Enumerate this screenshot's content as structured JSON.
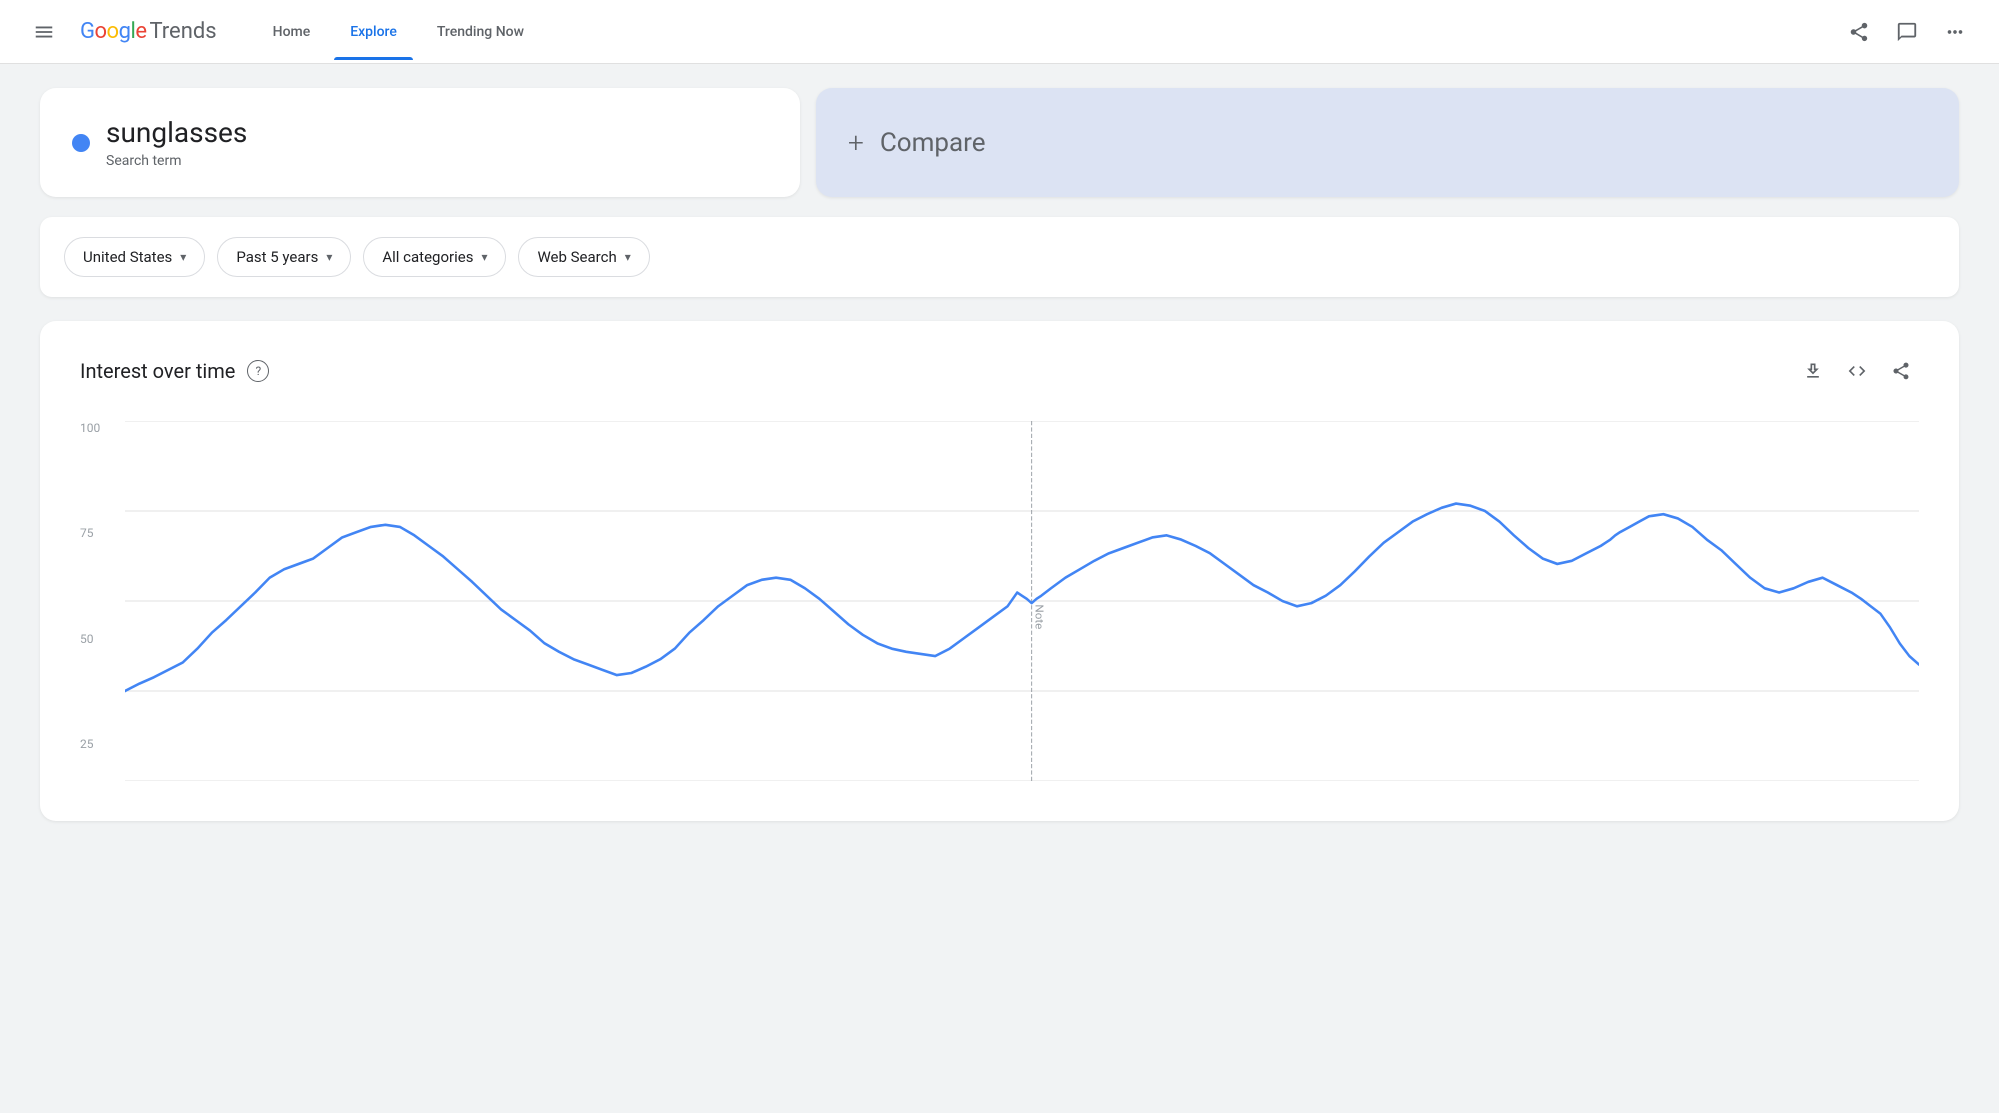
{
  "header": {
    "menu_label": "Menu",
    "logo_google": "Google",
    "logo_trends": "Trends",
    "nav": [
      {
        "id": "home",
        "label": "Home",
        "active": false
      },
      {
        "id": "explore",
        "label": "Explore",
        "active": true
      },
      {
        "id": "trending",
        "label": "Trending Now",
        "active": false
      }
    ]
  },
  "search_term": {
    "name": "sunglasses",
    "type": "Search term",
    "dot_color": "#4285F4"
  },
  "compare": {
    "plus": "+",
    "label": "Compare"
  },
  "filters": [
    {
      "id": "region",
      "label": "United States"
    },
    {
      "id": "period",
      "label": "Past 5 years"
    },
    {
      "id": "category",
      "label": "All categories"
    },
    {
      "id": "type",
      "label": "Web Search"
    }
  ],
  "chart": {
    "title": "Interest over time",
    "help_label": "?",
    "download_label": "Download",
    "embed_label": "Embed",
    "share_label": "Share",
    "y_labels": [
      "100",
      "75",
      "50",
      "25"
    ],
    "note_label": "Note"
  }
}
